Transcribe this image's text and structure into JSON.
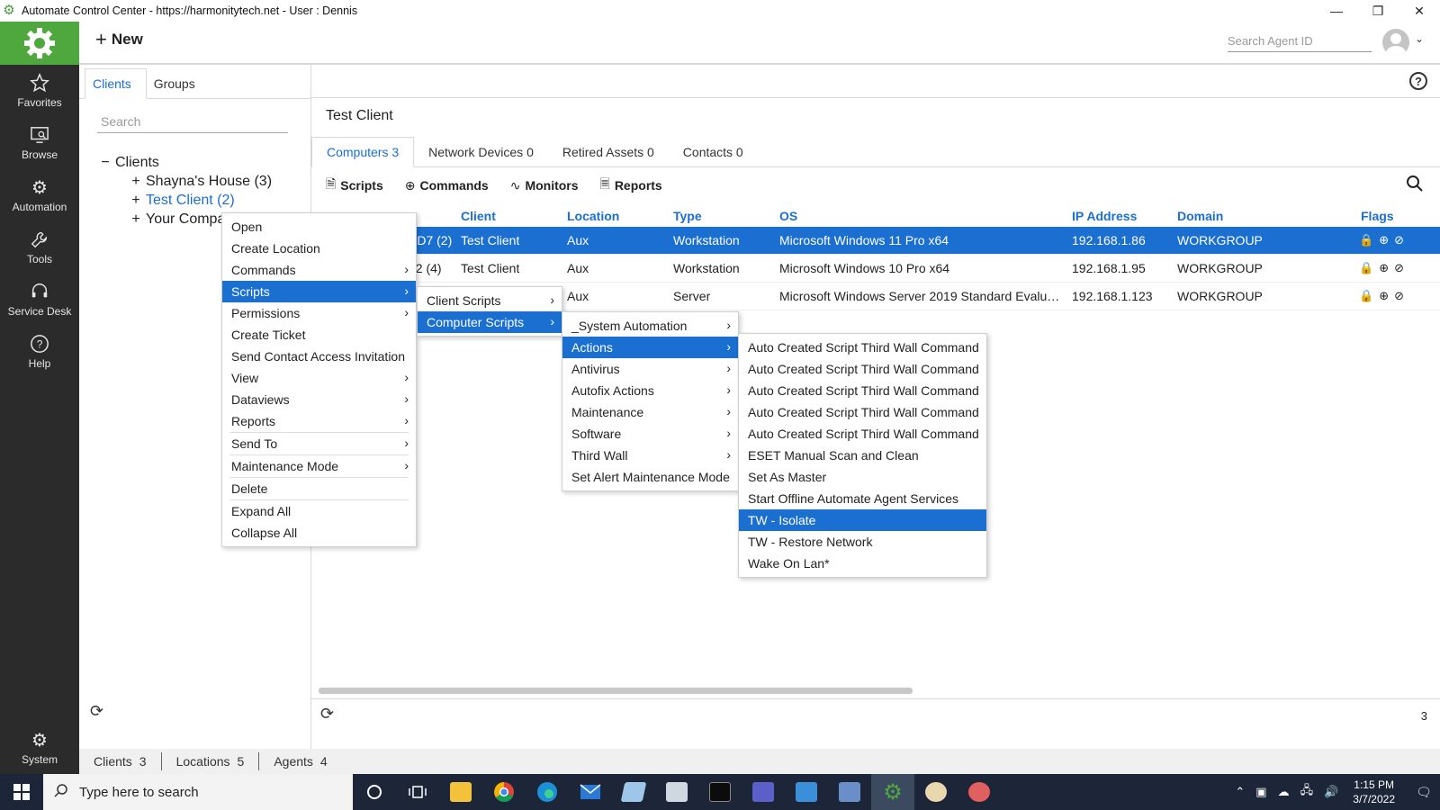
{
  "window": {
    "title": "Automate Control Center - https://harmonitytech.net - User : Dennis",
    "minimize": "—",
    "restore": "❐",
    "close": "✕"
  },
  "leftnav": {
    "items": [
      {
        "label": "Favorites",
        "icon": "star-icon"
      },
      {
        "label": "Browse",
        "icon": "browse-icon"
      },
      {
        "label": "Automation",
        "icon": "automation-icon"
      },
      {
        "label": "Tools",
        "icon": "tools-icon"
      },
      {
        "label": "Service Desk",
        "icon": "headset-icon"
      },
      {
        "label": "Help",
        "icon": "help-icon"
      }
    ],
    "system_label": "System"
  },
  "header": {
    "new_label": "New",
    "search_placeholder": "Search Agent ID"
  },
  "leftpanel": {
    "tabs": [
      "Clients",
      "Groups"
    ],
    "search_placeholder": "Search",
    "tree": {
      "root": "Clients",
      "children": [
        "Shayna's House (3)",
        "Test Client (2)",
        "Your Compa"
      ]
    }
  },
  "main": {
    "client_title": "Test Client",
    "tabs": [
      "Computers 3",
      "Network Devices 0",
      "Retired Assets 0",
      "Contacts 0"
    ],
    "toolbar": [
      "Scripts",
      "Commands",
      "Monitors",
      "Reports"
    ],
    "columns": [
      "Client",
      "Location",
      "Type",
      "OS",
      "IP Address",
      "Domain",
      "Flags"
    ],
    "rows": [
      {
        "computer": "PD7 (2)",
        "client": "Test Client",
        "location": "Aux",
        "type": "Workstation",
        "os": "Microsoft Windows 11 Pro x64",
        "ip": "192.168.1.86",
        "domain": "WORKGROUP"
      },
      {
        "computer": "32 (4)",
        "client": "Test Client",
        "location": "Aux",
        "type": "Workstation",
        "os": "Microsoft Windows 10 Pro x64",
        "ip": "192.168.1.95",
        "domain": "WORKGROUP"
      },
      {
        "computer": "",
        "client": "",
        "location": "Aux",
        "type": "Server",
        "os": "Microsoft Windows Server 2019 Standard Evaluat...",
        "ip": "192.168.1.123",
        "domain": "WORKGROUP"
      }
    ],
    "row_count": "3"
  },
  "statusbar": {
    "clients_label": "Clients",
    "clients_count": "3",
    "locations_label": "Locations",
    "locations_count": "5",
    "agents_label": "Agents",
    "agents_count": "4"
  },
  "menus": {
    "main": [
      "Open",
      "Create Location",
      "Commands",
      "Scripts",
      "Permissions",
      "Create Ticket",
      "Send Contact Access Invitation",
      "View",
      "Dataviews",
      "Reports",
      "Send To",
      "Maintenance Mode",
      "Delete",
      "Expand All",
      "Collapse All"
    ],
    "scripts": [
      "Client Scripts",
      "Computer Scripts"
    ],
    "computer_scripts": [
      "_System Automation",
      "Actions",
      "Antivirus",
      "Autofix Actions",
      "Maintenance",
      "Software",
      "Third Wall",
      "Set Alert Maintenance Mode"
    ],
    "actions": [
      "Auto Created Script Third Wall Command",
      "Auto Created Script Third Wall Command",
      "Auto Created Script Third Wall Command",
      "Auto Created Script Third Wall Command",
      "Auto Created Script Third Wall Command",
      "ESET Manual Scan and Clean",
      "Set As Master",
      "Start Offline Automate Agent Services",
      "TW - Isolate",
      "TW - Restore Network",
      "Wake On Lan*"
    ]
  },
  "taskbar": {
    "search_placeholder": "Type here to search",
    "time": "1:15 PM",
    "date": "3/7/2022"
  },
  "colors": {
    "accent": "#1a6fd0",
    "nav_bg": "#2b2b2b",
    "logo_green": "#4fa83d",
    "taskbar": "#1c2638"
  }
}
